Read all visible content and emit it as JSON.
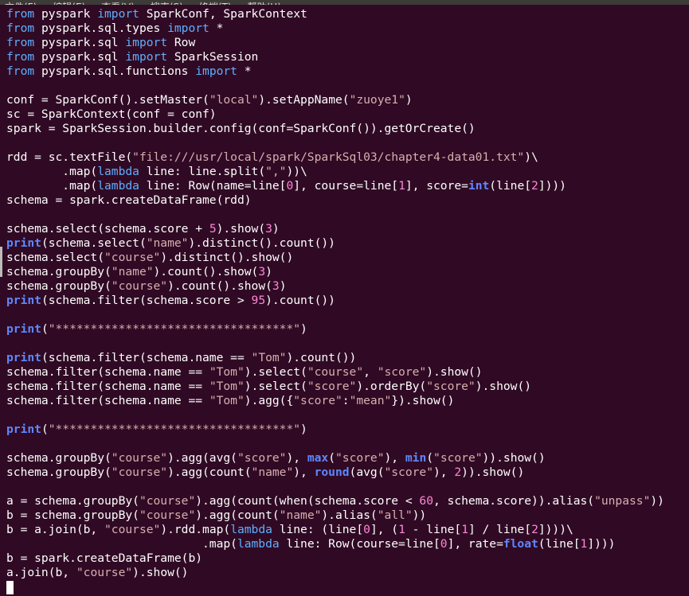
{
  "menu": {
    "items": [
      "文件(F)",
      "编辑(E)",
      "查看(V)",
      "搜索(S)",
      "终端(T)",
      "帮助(H)"
    ]
  },
  "editor": {
    "lines": [
      [
        {
          "t": "kw",
          "v": "from"
        },
        {
          "t": "",
          "v": " pyspark "
        },
        {
          "t": "kw",
          "v": "import"
        },
        {
          "t": "",
          "v": " SparkConf, SparkContext"
        }
      ],
      [
        {
          "t": "kw",
          "v": "from"
        },
        {
          "t": "",
          "v": " pyspark.sql.types "
        },
        {
          "t": "kw",
          "v": "import"
        },
        {
          "t": "",
          "v": " *"
        }
      ],
      [
        {
          "t": "kw",
          "v": "from"
        },
        {
          "t": "",
          "v": " pyspark.sql "
        },
        {
          "t": "kw",
          "v": "import"
        },
        {
          "t": "",
          "v": " Row"
        }
      ],
      [
        {
          "t": "kw",
          "v": "from"
        },
        {
          "t": "",
          "v": " pyspark.sql "
        },
        {
          "t": "kw",
          "v": "import"
        },
        {
          "t": "",
          "v": " SparkSession"
        }
      ],
      [
        {
          "t": "kw",
          "v": "from"
        },
        {
          "t": "",
          "v": " pyspark.sql.functions "
        },
        {
          "t": "kw",
          "v": "import"
        },
        {
          "t": "",
          "v": " *"
        }
      ],
      [],
      [
        {
          "t": "",
          "v": "conf = SparkConf().setMaster("
        },
        {
          "t": "str",
          "v": "\"local\""
        },
        {
          "t": "",
          "v": ").setAppName("
        },
        {
          "t": "str",
          "v": "\"zuoye1\""
        },
        {
          "t": "",
          "v": ")"
        }
      ],
      [
        {
          "t": "",
          "v": "sc = SparkContext(conf = conf)"
        }
      ],
      [
        {
          "t": "",
          "v": "spark = SparkSession.builder.config(conf=SparkConf()).getOrCreate()"
        }
      ],
      [],
      [
        {
          "t": "",
          "v": "rdd = sc.textFile("
        },
        {
          "t": "str",
          "v": "\"file:///usr/local/spark/SparkSql03/chapter4-data01.txt\""
        },
        {
          "t": "",
          "v": ")\\"
        }
      ],
      [
        {
          "t": "",
          "v": "        .map("
        },
        {
          "t": "kw",
          "v": "lambda"
        },
        {
          "t": "",
          "v": " line: line.split("
        },
        {
          "t": "str",
          "v": "\",\""
        },
        {
          "t": "",
          "v": "))\\"
        }
      ],
      [
        {
          "t": "",
          "v": "        .map("
        },
        {
          "t": "kw",
          "v": "lambda"
        },
        {
          "t": "",
          "v": " line: Row(name=line["
        },
        {
          "t": "num",
          "v": "0"
        },
        {
          "t": "",
          "v": "], course=line["
        },
        {
          "t": "num",
          "v": "1"
        },
        {
          "t": "",
          "v": "], score="
        },
        {
          "t": "fn",
          "v": "int"
        },
        {
          "t": "",
          "v": "(line["
        },
        {
          "t": "num",
          "v": "2"
        },
        {
          "t": "",
          "v": "])))"
        }
      ],
      [
        {
          "t": "",
          "v": "schema = spark.createDataFrame(rdd)"
        }
      ],
      [],
      [
        {
          "t": "",
          "v": "schema.select(schema.score + "
        },
        {
          "t": "num",
          "v": "5"
        },
        {
          "t": "",
          "v": ").show("
        },
        {
          "t": "num",
          "v": "3"
        },
        {
          "t": "",
          "v": ")"
        }
      ],
      [
        {
          "t": "fn",
          "v": "print"
        },
        {
          "t": "",
          "v": "(schema.select("
        },
        {
          "t": "str",
          "v": "\"name\""
        },
        {
          "t": "",
          "v": ").distinct().count())"
        }
      ],
      [
        {
          "t": "",
          "v": "schema.select("
        },
        {
          "t": "str",
          "v": "\"course\""
        },
        {
          "t": "",
          "v": ").distinct().show()"
        }
      ],
      [
        {
          "t": "",
          "v": "schema.groupBy("
        },
        {
          "t": "str",
          "v": "\"name\""
        },
        {
          "t": "",
          "v": ").count().show("
        },
        {
          "t": "num",
          "v": "3"
        },
        {
          "t": "",
          "v": ")"
        }
      ],
      [
        {
          "t": "",
          "v": "schema.groupBy("
        },
        {
          "t": "str",
          "v": "\"course\""
        },
        {
          "t": "",
          "v": ").count().show("
        },
        {
          "t": "num",
          "v": "3"
        },
        {
          "t": "",
          "v": ")"
        }
      ],
      [
        {
          "t": "fn",
          "v": "print"
        },
        {
          "t": "",
          "v": "(schema.filter(schema.score > "
        },
        {
          "t": "num",
          "v": "95"
        },
        {
          "t": "",
          "v": ").count())"
        }
      ],
      [],
      [
        {
          "t": "fn",
          "v": "print"
        },
        {
          "t": "",
          "v": "("
        },
        {
          "t": "str",
          "v": "\"**********************************\""
        },
        {
          "t": "",
          "v": ")"
        }
      ],
      [],
      [
        {
          "t": "fn",
          "v": "print"
        },
        {
          "t": "",
          "v": "(schema.filter(schema.name == "
        },
        {
          "t": "str",
          "v": "\"Tom\""
        },
        {
          "t": "",
          "v": ").count())"
        }
      ],
      [
        {
          "t": "",
          "v": "schema.filter(schema.name == "
        },
        {
          "t": "str",
          "v": "\"Tom\""
        },
        {
          "t": "",
          "v": ").select("
        },
        {
          "t": "str",
          "v": "\"course\""
        },
        {
          "t": "",
          "v": ", "
        },
        {
          "t": "str",
          "v": "\"score\""
        },
        {
          "t": "",
          "v": ").show()"
        }
      ],
      [
        {
          "t": "",
          "v": "schema.filter(schema.name == "
        },
        {
          "t": "str",
          "v": "\"Tom\""
        },
        {
          "t": "",
          "v": ").select("
        },
        {
          "t": "str",
          "v": "\"score\""
        },
        {
          "t": "",
          "v": ").orderBy("
        },
        {
          "t": "str",
          "v": "\"score\""
        },
        {
          "t": "",
          "v": ").show()"
        }
      ],
      [
        {
          "t": "",
          "v": "schema.filter(schema.name == "
        },
        {
          "t": "str",
          "v": "\"Tom\""
        },
        {
          "t": "",
          "v": ").agg({"
        },
        {
          "t": "str",
          "v": "\"score\""
        },
        {
          "t": "",
          "v": ":"
        },
        {
          "t": "str",
          "v": "\"mean\""
        },
        {
          "t": "",
          "v": "}).show()"
        }
      ],
      [],
      [
        {
          "t": "fn",
          "v": "print"
        },
        {
          "t": "",
          "v": "("
        },
        {
          "t": "str",
          "v": "\"**********************************\""
        },
        {
          "t": "",
          "v": ")"
        }
      ],
      [],
      [
        {
          "t": "",
          "v": "schema.groupBy("
        },
        {
          "t": "str",
          "v": "\"course\""
        },
        {
          "t": "",
          "v": ").agg(avg("
        },
        {
          "t": "str",
          "v": "\"score\""
        },
        {
          "t": "",
          "v": "), "
        },
        {
          "t": "fn",
          "v": "max"
        },
        {
          "t": "",
          "v": "("
        },
        {
          "t": "str",
          "v": "\"score\""
        },
        {
          "t": "",
          "v": "), "
        },
        {
          "t": "fn",
          "v": "min"
        },
        {
          "t": "",
          "v": "("
        },
        {
          "t": "str",
          "v": "\"score\""
        },
        {
          "t": "",
          "v": ")).show()"
        }
      ],
      [
        {
          "t": "",
          "v": "schema.groupBy("
        },
        {
          "t": "str",
          "v": "\"course\""
        },
        {
          "t": "",
          "v": ").agg(count("
        },
        {
          "t": "str",
          "v": "\"name\""
        },
        {
          "t": "",
          "v": "), "
        },
        {
          "t": "fn",
          "v": "round"
        },
        {
          "t": "",
          "v": "(avg("
        },
        {
          "t": "str",
          "v": "\"score\""
        },
        {
          "t": "",
          "v": "), "
        },
        {
          "t": "num",
          "v": "2"
        },
        {
          "t": "",
          "v": ")).show()"
        }
      ],
      [],
      [
        {
          "t": "",
          "v": "a = schema.groupBy("
        },
        {
          "t": "str",
          "v": "\"course\""
        },
        {
          "t": "",
          "v": ").agg(count(when(schema.score < "
        },
        {
          "t": "num",
          "v": "60"
        },
        {
          "t": "",
          "v": ", schema.score)).alias("
        },
        {
          "t": "str",
          "v": "\"unpass\""
        },
        {
          "t": "",
          "v": "))"
        }
      ],
      [
        {
          "t": "",
          "v": "b = schema.groupBy("
        },
        {
          "t": "str",
          "v": "\"course\""
        },
        {
          "t": "",
          "v": ").agg(count("
        },
        {
          "t": "str",
          "v": "\"name\""
        },
        {
          "t": "",
          "v": ").alias("
        },
        {
          "t": "str",
          "v": "\"all\""
        },
        {
          "t": "",
          "v": "))"
        }
      ],
      [
        {
          "t": "",
          "v": "b = a.join(b, "
        },
        {
          "t": "str",
          "v": "\"course\""
        },
        {
          "t": "",
          "v": ").rdd.map("
        },
        {
          "t": "kw",
          "v": "lambda"
        },
        {
          "t": "",
          "v": " line: (line["
        },
        {
          "t": "num",
          "v": "0"
        },
        {
          "t": "",
          "v": "], ("
        },
        {
          "t": "num",
          "v": "1"
        },
        {
          "t": "",
          "v": " - line["
        },
        {
          "t": "num",
          "v": "1"
        },
        {
          "t": "",
          "v": "] / line["
        },
        {
          "t": "num",
          "v": "2"
        },
        {
          "t": "",
          "v": "])))\\"
        }
      ],
      [
        {
          "t": "",
          "v": "                            .map("
        },
        {
          "t": "kw",
          "v": "lambda"
        },
        {
          "t": "",
          "v": " line: Row(course=line["
        },
        {
          "t": "num",
          "v": "0"
        },
        {
          "t": "",
          "v": "], rate="
        },
        {
          "t": "fn",
          "v": "float"
        },
        {
          "t": "",
          "v": "(line["
        },
        {
          "t": "num",
          "v": "1"
        },
        {
          "t": "",
          "v": "])))"
        }
      ],
      [
        {
          "t": "",
          "v": "b = spark.createDataFrame(b)"
        }
      ],
      [
        {
          "t": "",
          "v": "a.join(b, "
        },
        {
          "t": "str",
          "v": "\"course\""
        },
        {
          "t": "",
          "v": ").show()"
        }
      ]
    ]
  }
}
